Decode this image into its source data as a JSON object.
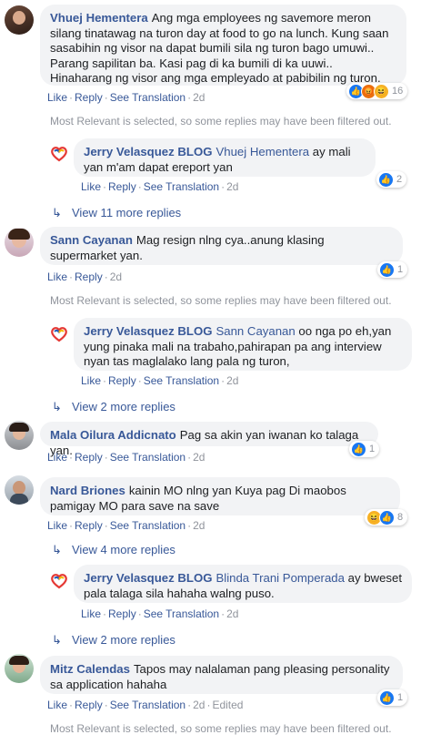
{
  "common": {
    "like": "Like",
    "reply": "Reply",
    "see_translation": "See Translation",
    "edited": "Edited",
    "dot": "·"
  },
  "filter_text": "Most Relevant is selected, so some replies may have been filtered out.",
  "comments": [
    {
      "author": "Vhuej Hementera",
      "text": "Ang mga employees ng savemore meron silang tinatawag na turon day at food to go na lunch. Kung saan sasabihin ng visor na dapat bumili sila ng turon bago umuwi.. Parang sapilitan ba. Kasi pag di ka bumili di ka uuwi.. Hinaharang ng visor ang mga empleyado at pabibilin ng turon.",
      "time": "2d",
      "reactions": [
        "like",
        "angry",
        "haha"
      ],
      "reaction_count": "16"
    },
    {
      "author": "Jerry Velasquez BLOG",
      "mention": "Vhuej Hementera",
      "text": "ay mali yan m'am dapat ereport yan",
      "time": "2d",
      "reactions": [
        "like"
      ],
      "reaction_count": "2"
    },
    {
      "author": "Sann Cayanan",
      "text": "Mag resign nlng cya..anung klasing supermarket yan.",
      "time": "2d",
      "reactions": [
        "like"
      ],
      "reaction_count": "1"
    },
    {
      "author": "Jerry Velasquez BLOG",
      "mention": "Sann Cayanan",
      "text": "oo nga po eh,yan yung pinaka mali na trabaho,pahirapan pa ang interview nyan tas maglalako lang pala ng turon,",
      "time": "2d"
    },
    {
      "author": "Mala Oilura Addicnato",
      "text": "Pag sa akin yan iwanan ko talaga yan.",
      "time": "2d",
      "reactions": [
        "like"
      ],
      "reaction_count": "1"
    },
    {
      "author": "Nard Briones",
      "text": "kainin MO nlng yan Kuya pag Di maobos pamigay MO para save na save",
      "time": "2d",
      "reactions": [
        "haha",
        "like"
      ],
      "reaction_count": "8"
    },
    {
      "author": "Jerry Velasquez BLOG",
      "mention": "Blinda Trani Pomperada",
      "text": "ay bweset pala talaga sila hahaha walng puso.",
      "time": "2d"
    },
    {
      "author": "Mitz Calendas",
      "text": "Tapos may nalalaman pang pleasing personality sa application hahaha",
      "time": "2d",
      "reactions": [
        "like"
      ],
      "reaction_count": "1"
    }
  ],
  "view_more": [
    "View 11 more replies",
    "View 2 more replies",
    "View 4 more replies",
    "View 2 more replies"
  ],
  "colors": {
    "link": "#385898",
    "meta": "#90949c",
    "bubble": "#f2f3f5"
  }
}
